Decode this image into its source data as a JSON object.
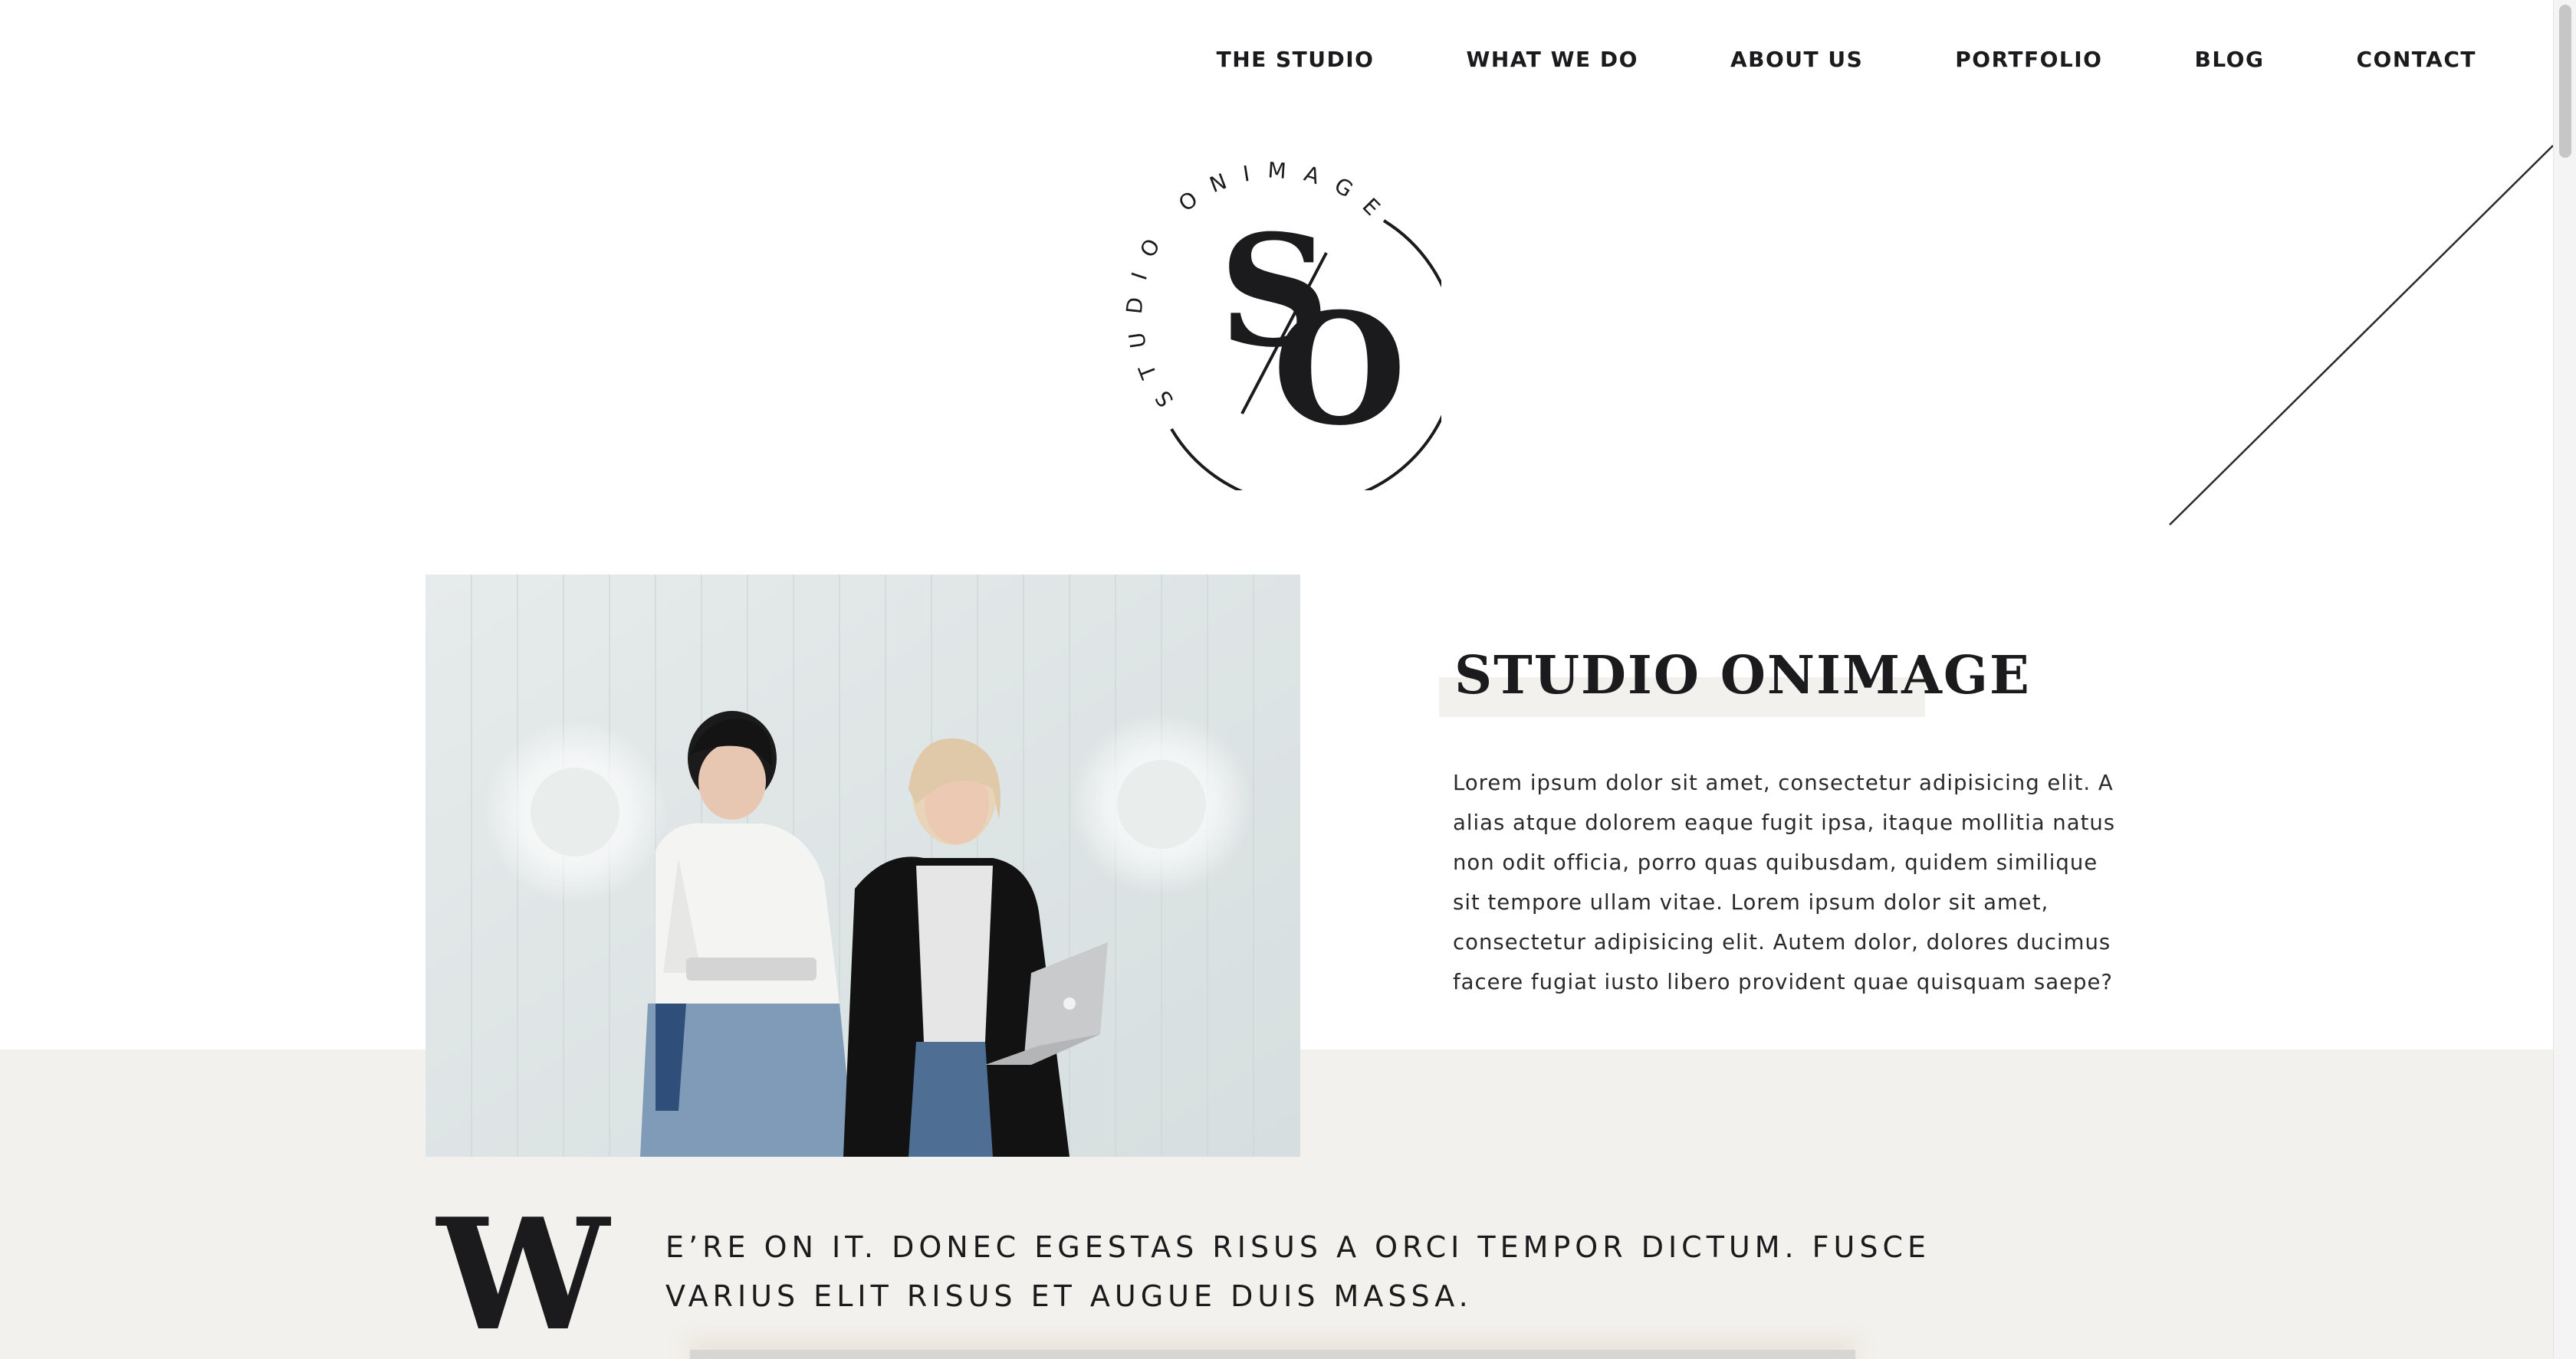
{
  "nav": {
    "items": [
      {
        "label": "THE STUDIO"
      },
      {
        "label": "WHAT WE DO"
      },
      {
        "label": "ABOUT US"
      },
      {
        "label": "PORTFOLIO"
      },
      {
        "label": "BLOG"
      },
      {
        "label": "CONTACT"
      }
    ]
  },
  "logo": {
    "ring_text": "STUDIO ONIMAGE",
    "monogram_s": "S",
    "monogram_o": "O"
  },
  "intro": {
    "title": "STUDIO ONIMAGE",
    "body": "Lorem ipsum dolor sit amet, consectetur adipisicing elit. A alias atque dolorem eaque fugit ipsa, itaque mollitia natus non odit officia, porro quas quibusdam, quidem similique sit tempore ullam vitae. Lorem ipsum dolor sit amet, consectetur adipisicing elit. Autem dolor, dolores ducimus facere fugiat iusto libero provident quae quisquam saepe?"
  },
  "statement": {
    "drop_cap": "W",
    "text": "E’RE ON IT. DONEC EGESTAS RISUS A ORCI TEMPOR DICTUM. FUSCE VARIUS ELIT RISUS ET AUGUE DUIS MASSA."
  },
  "colors": {
    "ink": "#1b1b1d",
    "band": "#f3f1ed",
    "photo_wall": "#dfe5e6"
  }
}
